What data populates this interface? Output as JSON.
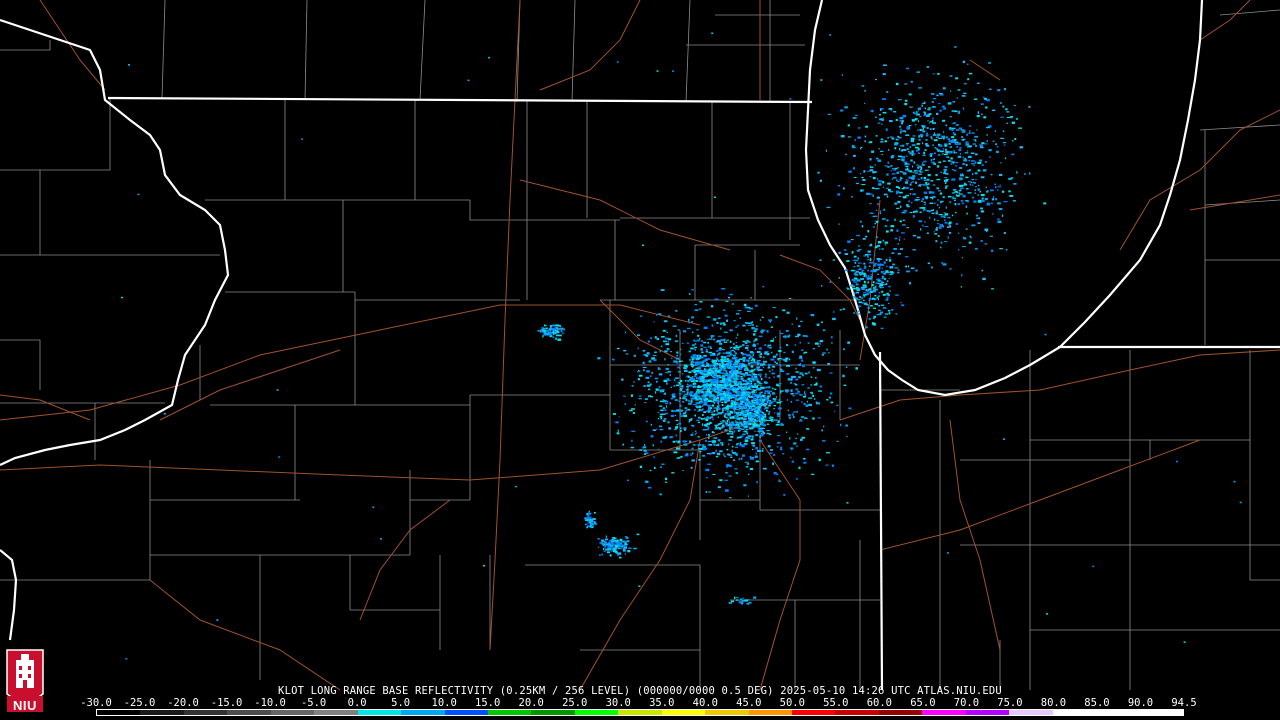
{
  "product": {
    "caption": "KLOT LONG RANGE BASE REFLECTIVITY (0.25KM / 256 LEVEL) (000000/0000 0.5 DEG) 2025-05-10 14:26 UTC  ATLAS.NIU.EDU"
  },
  "scale": {
    "labels": [
      "-30.0",
      "-25.0",
      "-20.0",
      "-15.0",
      "-10.0",
      "-5.0",
      "0.0",
      "5.0",
      "10.0",
      "15.0",
      "20.0",
      "25.0",
      "30.0",
      "35.0",
      "40.0",
      "45.0",
      "50.0",
      "55.0",
      "60.0",
      "65.0",
      "70.0",
      "75.0",
      "80.0",
      "85.0",
      "90.0",
      "94.5"
    ],
    "colors": [
      "#000000",
      "#1a1a1a",
      "#333333",
      "#4d4d4d",
      "#666666",
      "#808080",
      "#00e5e5",
      "#00a8f0",
      "#0050ff",
      "#00c800",
      "#009600",
      "#00ff00",
      "#c8e600",
      "#ffff00",
      "#f0c800",
      "#ff9600",
      "#ff0000",
      "#c80000",
      "#960000",
      "#ff00ff",
      "#b400ff",
      "#e6c8ff",
      "#ffffff",
      "#ffffff",
      "#ffffff"
    ]
  },
  "logo": {
    "text": "NIU",
    "icon": "university-tower-icon",
    "color": "#c8102e"
  },
  "map_style": {
    "state_border": "#ffffff",
    "county_lines": "#8c8c8c",
    "roads": "#a0522d",
    "echo_colors": [
      "#00e5e5",
      "#00a8f0",
      "#0080ff",
      "#1fb8ff"
    ]
  },
  "radar": {
    "site": "KLOT"
  }
}
